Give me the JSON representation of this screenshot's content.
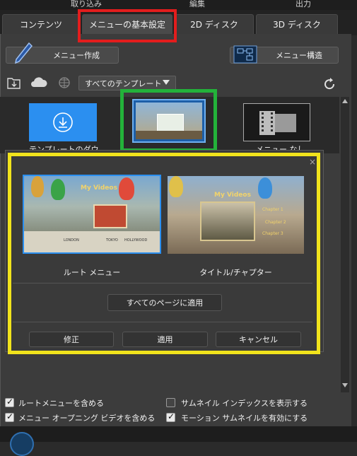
{
  "top_menu": {
    "items": [
      "取り込み",
      "編集",
      "出力"
    ]
  },
  "tabs": [
    {
      "label": "コンテンツ"
    },
    {
      "label": "メニューの基本設定"
    },
    {
      "label": "2D ディスク"
    },
    {
      "label": "3D ディスク"
    }
  ],
  "toolbar": {
    "create_menu": "メニュー作成",
    "menu_structure": "メニュー構造",
    "template_filter": "すべてのテンプレート"
  },
  "template_strip": {
    "download_caption": "テンプレートのダウ",
    "right_caption": "メニュー なし"
  },
  "dialog": {
    "preview_left": {
      "label": "ルート メニュー",
      "title_text": "My Videos",
      "signs": [
        "LONDON",
        "TOKYO",
        "HOLLYWOOD"
      ]
    },
    "preview_right": {
      "label": "タイトル/チャプター",
      "title_text": "My Videos",
      "chapters": [
        "Chapter 1",
        "Chapter 2",
        "Chapter 3"
      ]
    },
    "apply_all": "すべてのページに適用",
    "edit": "修正",
    "apply": "適用",
    "cancel": "キャンセル"
  },
  "options": {
    "include_root": {
      "label": "ルートメニューを含める",
      "checked": true
    },
    "include_opening": {
      "label": "メニュー オープニング ビデオを含める",
      "checked": true
    },
    "show_index": {
      "label": "サムネイル インデックスを表示する",
      "checked": false
    },
    "motion_thumbs": {
      "label": "モーション サムネイルを有効にする",
      "checked": true
    }
  },
  "colors": {
    "highlight_red": "#e31d1d",
    "highlight_green": "#23b23a",
    "highlight_yellow": "#f1e31c",
    "accent_blue": "#2b8ff0"
  }
}
